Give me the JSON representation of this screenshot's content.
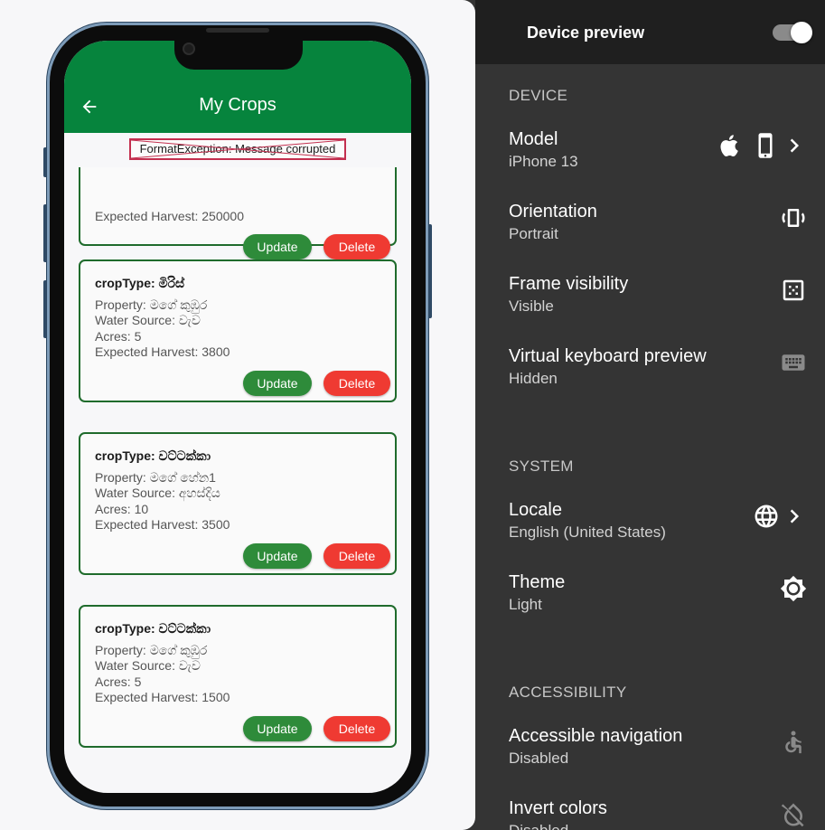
{
  "app": {
    "title": "My Crops",
    "error_text": "FormatException: Message corrupted"
  },
  "partial_card": {
    "harvest": "Expected Harvest: 250000",
    "update_label": "Update",
    "delete_label": "Delete"
  },
  "crops": [
    {
      "type": "cropType: මිරිස්",
      "property": "Property: මගේ කුඹුර",
      "water": "Water Source: වැව",
      "acres": "Acres: 5",
      "harvest": "Expected Harvest: 3800",
      "update_label": "Update",
      "delete_label": "Delete"
    },
    {
      "type": "cropType: වට්ටක්කා",
      "property": "Property: මගේ හේන1",
      "water": "Water Source: අහස්දිය",
      "acres": "Acres: 10",
      "harvest": "Expected Harvest: 3500",
      "update_label": "Update",
      "delete_label": "Delete"
    },
    {
      "type": "cropType: වට්ටක්කා",
      "property": "Property: මගේ කුඹුර",
      "water": "Water Source: වැව",
      "acres": "Acres: 5",
      "harvest": "Expected Harvest: 1500",
      "update_label": "Update",
      "delete_label": "Delete"
    }
  ],
  "panel": {
    "title": "Device preview",
    "enabled": true,
    "sections": {
      "device": "DEVICE",
      "system": "SYSTEM",
      "accessibility": "ACCESSIBILITY"
    },
    "settings": {
      "model": {
        "title": "Model",
        "value": "iPhone 13"
      },
      "orientation": {
        "title": "Orientation",
        "value": "Portrait"
      },
      "frame": {
        "title": "Frame visibility",
        "value": "Visible"
      },
      "keyboard": {
        "title": "Virtual keyboard preview",
        "value": "Hidden"
      },
      "locale": {
        "title": "Locale",
        "value": "English (United States)"
      },
      "theme": {
        "title": "Theme",
        "value": "Light"
      },
      "accessible_nav": {
        "title": "Accessible navigation",
        "value": "Disabled"
      },
      "invert": {
        "title": "Invert colors",
        "value": "Disabled"
      }
    }
  },
  "colors": {
    "app_bar": "#06843d",
    "update_button": "#2e8b3a",
    "delete_button": "#ef3a32",
    "card_border": "#1f6b2c",
    "panel_bg": "#343434",
    "panel_header_bg": "#1f1f1f"
  },
  "icons": [
    "back-arrow-icon",
    "apple-icon",
    "phone-icon",
    "chevron-right-icon",
    "screen-rotation-icon",
    "frame-icon",
    "keyboard-icon",
    "globe-icon",
    "brightness-icon",
    "accessibility-icon",
    "invert-colors-off-icon"
  ]
}
